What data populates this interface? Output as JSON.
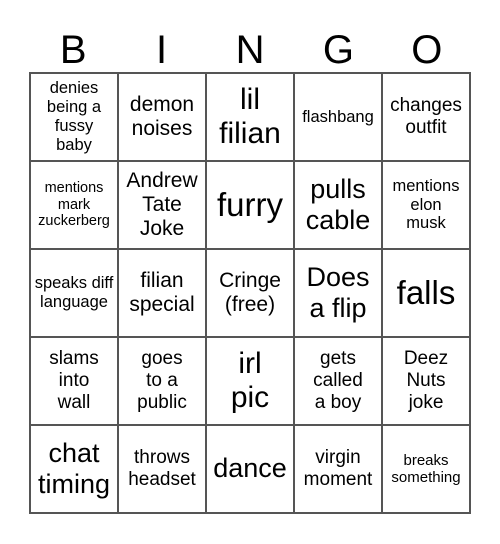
{
  "header": [
    "B",
    "I",
    "N",
    "G",
    "O"
  ],
  "cells": [
    [
      "denies being a fussy baby",
      "demon noises",
      "lil filian",
      "flashbang",
      "changes outfit"
    ],
    [
      "mentions mark zuckerberg",
      "Andrew Tate Joke",
      "furry",
      "pulls cable",
      "mentions elon musk"
    ],
    [
      "speaks diff language",
      "filian special",
      "Cringe (free)",
      "Does a flip",
      "falls"
    ],
    [
      "slams into wall",
      "goes to a public",
      "irl pic",
      "gets called a boy",
      "Deez Nuts joke"
    ],
    [
      "chat timing",
      "throws headset",
      "dance",
      "virgin moment",
      "breaks something"
    ]
  ]
}
